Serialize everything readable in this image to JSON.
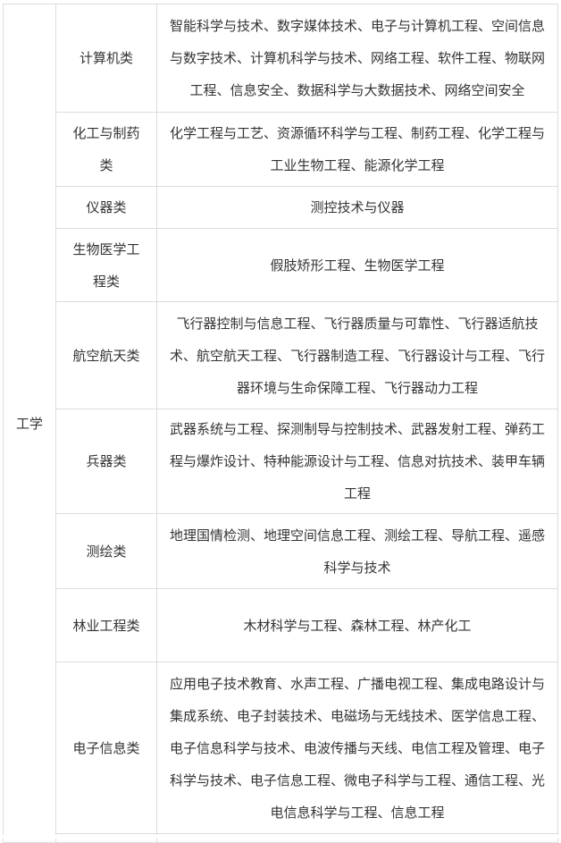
{
  "discipline": "工学",
  "rows": [
    {
      "category": "计算机类",
      "majors": "智能科学与技术、数字媒体技术、电子与计算机工程、空间信息与数字技术、计算机科学与技术、网络工程、软件工程、物联网工程、信息安全、数据科学与大数据技术、网络空间安全"
    },
    {
      "category": "化工与制药类",
      "majors": "化学工程与工艺、资源循环科学与工程、制药工程、化学工程与工业生物工程、能源化学工程"
    },
    {
      "category": "仪器类",
      "majors": "测控技术与仪器"
    },
    {
      "category": "生物医学工程类",
      "majors": "假肢矫形工程、生物医学工程"
    },
    {
      "category": "航空航天类",
      "majors": "飞行器控制与信息工程、飞行器质量与可靠性、飞行器适航技术、航空航天工程、飞行器制造工程、飞行器设计与工程、飞行器环境与生命保障工程、飞行器动力工程"
    },
    {
      "category": "兵器类",
      "majors": "武器系统与工程、探测制导与控制技术、武器发射工程、弹药工程与爆炸设计、特种能源设计与工程、信息对抗技术、装甲车辆工程"
    },
    {
      "category": "测绘类",
      "majors": "地理国情检测、地理空间信息工程、测绘工程、导航工程、遥感科学与技术"
    },
    {
      "category": "林业工程类",
      "majors": "木材科学与工程、森林工程、林产化工"
    },
    {
      "category": "电子信息类",
      "majors": "应用电子技术教育、水声工程、广播电视工程、集成电路设计与集成系统、电子封装技术、电磁场与无线技术、医学信息工程、电子信息科学与技术、电波传播与天线、电信工程及管理、电子科学与技术、电子信息工程、微电子科学与工程、通信工程、光电信息科学与工程、信息工程"
    }
  ]
}
